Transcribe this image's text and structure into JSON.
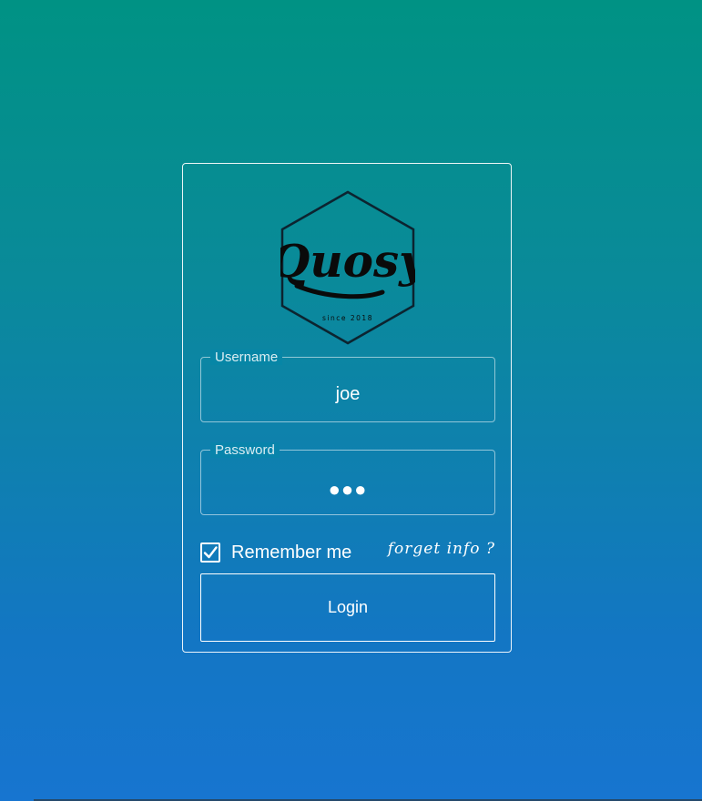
{
  "logo": {
    "brand": "Quosy",
    "tagline": "since 2018",
    "icon": "hexagon-logo"
  },
  "form": {
    "username": {
      "label": "Username",
      "value": "joe"
    },
    "password": {
      "label": "Password",
      "masked_value": "●●●"
    },
    "remember": {
      "label": "Remember me",
      "checked": true
    },
    "forget_link": "forget info ?",
    "login_label": "Login"
  },
  "colors": {
    "gradient_top": "#009284",
    "gradient_bottom": "#1775d0",
    "foreground": "#ffffff"
  }
}
